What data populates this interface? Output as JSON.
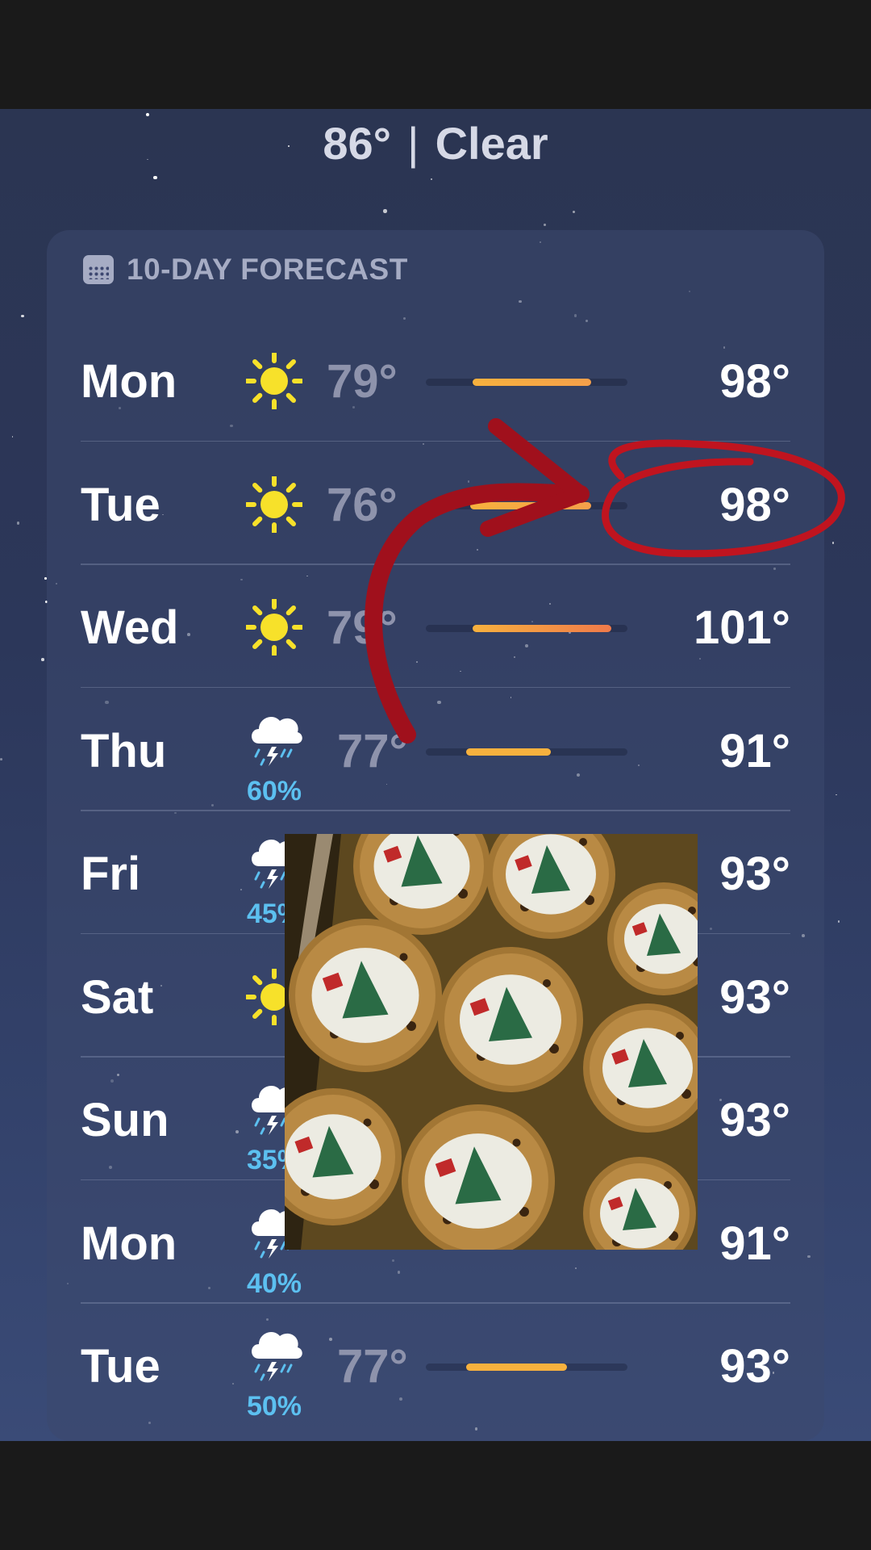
{
  "current": {
    "temperature": "86°",
    "separator": "|",
    "condition": "Clear"
  },
  "forecast": {
    "header_label": "10-DAY FORECAST",
    "header_icon": "calendar-icon",
    "days": [
      {
        "day": "Mon",
        "icon": "sun-icon",
        "precip": "",
        "low": "79°",
        "high": "98°",
        "range_start": 0.23,
        "range_end": 0.82,
        "bar_color": "#f5a04a"
      },
      {
        "day": "Tue",
        "icon": "sun-icon",
        "precip": "",
        "low": "76°",
        "high": "98°",
        "range_start": 0.22,
        "range_end": 0.82,
        "bar_color": "#f5a04a"
      },
      {
        "day": "Wed",
        "icon": "sun-icon",
        "precip": "",
        "low": "79°",
        "high": "101°",
        "range_start": 0.23,
        "range_end": 0.92,
        "bar_color": "#f07a4a"
      },
      {
        "day": "Thu",
        "icon": "cloud-bolt-rain-icon",
        "precip": "60%",
        "low": "77°",
        "high": "91°",
        "range_start": 0.2,
        "range_end": 0.62,
        "bar_color": "#f7b13e"
      },
      {
        "day": "Fri",
        "icon": "cloud-bolt-rain-icon",
        "precip": "45%",
        "low": "",
        "high": "93°",
        "range_start": 0.2,
        "range_end": 0.7,
        "bar_color": "#f7b13e"
      },
      {
        "day": "Sat",
        "icon": "sun-icon",
        "precip": "",
        "low": "",
        "high": "93°",
        "range_start": 0.2,
        "range_end": 0.7,
        "bar_color": "#f7b13e"
      },
      {
        "day": "Sun",
        "icon": "cloud-bolt-rain-icon",
        "precip": "35%",
        "low": "",
        "high": "93°",
        "range_start": 0.2,
        "range_end": 0.7,
        "bar_color": "#f7b13e"
      },
      {
        "day": "Mon",
        "icon": "cloud-bolt-rain-icon",
        "precip": "40%",
        "low": "",
        "high": "91°",
        "range_start": 0.2,
        "range_end": 0.62,
        "bar_color": "#f7b13e"
      },
      {
        "day": "Tue",
        "icon": "cloud-bolt-rain-icon",
        "precip": "50%",
        "low": "77°",
        "high": "93°",
        "range_start": 0.2,
        "range_end": 0.7,
        "bar_color": "#f7b13e"
      }
    ]
  },
  "overlays": {
    "annotation": "red-arrow-and-circle-around-tue-high",
    "photo": "frosted-christmas-tree-cookies-photo",
    "annotation_color": "#c0141f"
  }
}
